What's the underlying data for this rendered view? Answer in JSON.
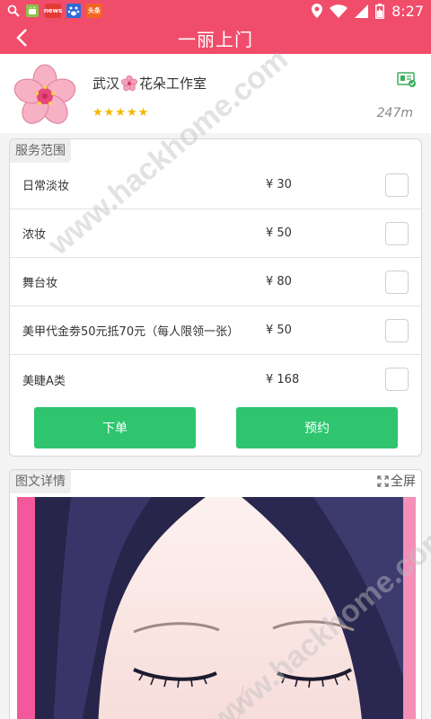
{
  "status_bar": {
    "time": "8:27",
    "left_icons": [
      "search-icon",
      "android-icon",
      "news-app-icon",
      "baidu-app-icon",
      "toutiao-app-icon"
    ],
    "news_badge": "news",
    "toutiao_badge": "头条",
    "right_icons": [
      "location-icon",
      "wifi-icon",
      "signal-icon",
      "battery-icon"
    ]
  },
  "header": {
    "title": "一丽上门",
    "background": "#f04d6b"
  },
  "shop": {
    "name_prefix": "武汉",
    "name_suffix": "花朵工作室",
    "stars": "★★★★★",
    "rating": 5,
    "distance": "247m",
    "logo_icon": "cherry-blossom-icon",
    "license_icon": "license-icon"
  },
  "services": {
    "title": "服务范围",
    "items": [
      {
        "name": "日常淡妆",
        "price": "¥  30",
        "checked": false
      },
      {
        "name": "浓妆",
        "price": "¥  50",
        "checked": false
      },
      {
        "name": "舞台妆",
        "price": "¥  80",
        "checked": false
      },
      {
        "name": "美甲代金劵50元抵70元（每人限领一张）",
        "price": "¥  50",
        "checked": false
      },
      {
        "name": "美睫A类",
        "price": "¥  168",
        "checked": false
      }
    ],
    "order_label": "下单",
    "book_label": "预约",
    "button_color": "#2ec56e"
  },
  "details": {
    "title": "图文详情",
    "fullscreen_label": "全屏"
  },
  "watermark": {
    "text": "www.hackhome.com"
  }
}
